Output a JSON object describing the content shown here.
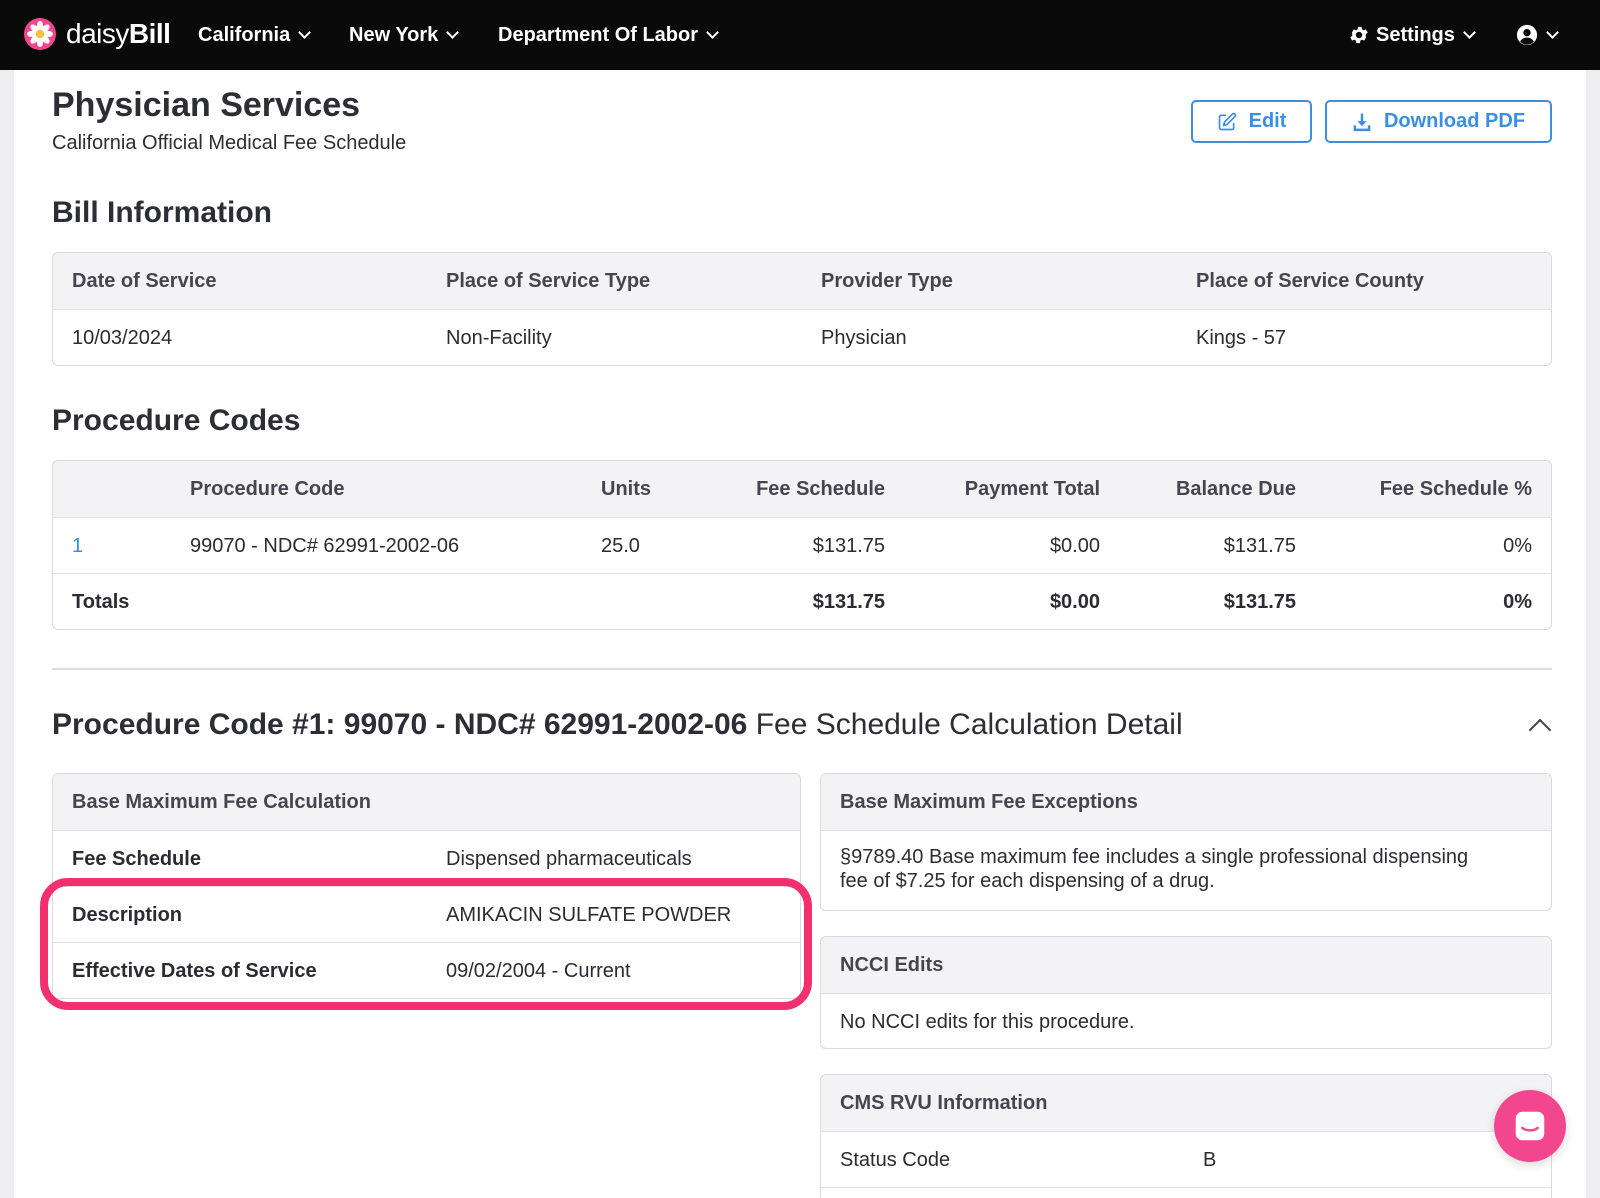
{
  "brand": {
    "name_light": "daisy",
    "name_bold": "Bill",
    "accent": "#f2468e"
  },
  "nav": {
    "items": [
      {
        "label": "California"
      },
      {
        "label": "New York"
      },
      {
        "label": "Department Of Labor"
      }
    ],
    "settings_label": "Settings",
    "user_icon": "user-circle-icon"
  },
  "header": {
    "title": "Physician Services",
    "subtitle": "California Official Medical Fee Schedule",
    "edit_label": "Edit",
    "download_label": "Download PDF"
  },
  "bill_info": {
    "title": "Bill Information",
    "columns": [
      "Date of Service",
      "Place of Service Type",
      "Provider Type",
      "Place of Service County"
    ],
    "values": [
      "10/03/2024",
      "Non-Facility",
      "Physician",
      "Kings - 57"
    ]
  },
  "procedure_codes": {
    "title": "Procedure Codes",
    "columns": [
      "Procedure Code",
      "Units",
      "Fee Schedule",
      "Payment Total",
      "Balance Due",
      "Fee Schedule %"
    ],
    "rows": [
      {
        "num": "1",
        "code": "99070 - NDC# 62991-2002-06",
        "units": "25.0",
        "fee_schedule": "$131.75",
        "payment_total": "$0.00",
        "balance_due": "$131.75",
        "fee_pct": "0%"
      }
    ],
    "totals": {
      "label": "Totals",
      "fee_schedule": "$131.75",
      "payment_total": "$0.00",
      "balance_due": "$131.75",
      "fee_pct": "0%"
    }
  },
  "detail": {
    "title_bold": "Procedure Code #1: 99070 - NDC# 62991-2002-06",
    "title_rest": "Fee Schedule Calculation Detail",
    "base_fee": {
      "title": "Base Maximum Fee Calculation",
      "rows": [
        {
          "label": "Fee Schedule",
          "value": "Dispensed pharmaceuticals"
        },
        {
          "label": "Description",
          "value": "AMIKACIN SULFATE POWDER"
        },
        {
          "label": "Effective Dates of Service",
          "value": "09/02/2004 - Current"
        }
      ]
    },
    "exceptions": {
      "title": "Base Maximum Fee Exceptions",
      "text_line1": "§9789.40 Base maximum fee includes a single professional dispensing",
      "text_line2": "fee of $7.25 for each dispensing of a drug."
    },
    "ncci": {
      "title": "NCCI Edits",
      "text": "No NCCI edits for this procedure."
    },
    "cms_rvu": {
      "title": "CMS RVU Information",
      "rows": [
        {
          "label": "Status Code",
          "value": "B"
        }
      ]
    }
  },
  "colors": {
    "link": "#3a8ee6",
    "highlight": "#f2306e",
    "navbar": "#0a0a0a"
  }
}
